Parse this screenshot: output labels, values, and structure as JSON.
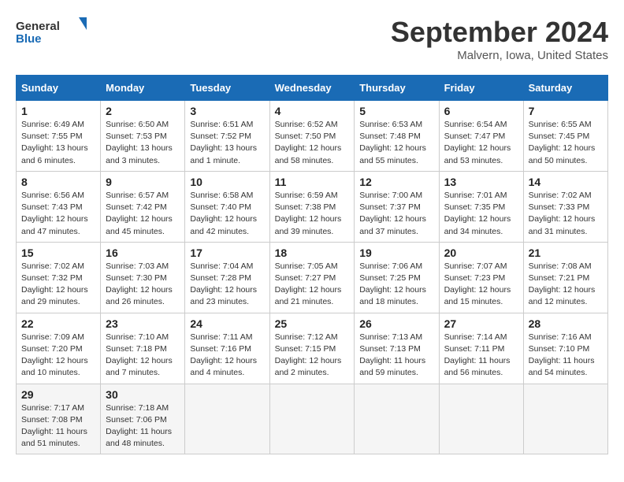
{
  "logo": {
    "line1": "General",
    "line2": "Blue"
  },
  "title": "September 2024",
  "location": "Malvern, Iowa, United States",
  "days_header": [
    "Sunday",
    "Monday",
    "Tuesday",
    "Wednesday",
    "Thursday",
    "Friday",
    "Saturday"
  ],
  "weeks": [
    [
      {
        "day": "1",
        "info": "Sunrise: 6:49 AM\nSunset: 7:55 PM\nDaylight: 13 hours\nand 6 minutes."
      },
      {
        "day": "2",
        "info": "Sunrise: 6:50 AM\nSunset: 7:53 PM\nDaylight: 13 hours\nand 3 minutes."
      },
      {
        "day": "3",
        "info": "Sunrise: 6:51 AM\nSunset: 7:52 PM\nDaylight: 13 hours\nand 1 minute."
      },
      {
        "day": "4",
        "info": "Sunrise: 6:52 AM\nSunset: 7:50 PM\nDaylight: 12 hours\nand 58 minutes."
      },
      {
        "day": "5",
        "info": "Sunrise: 6:53 AM\nSunset: 7:48 PM\nDaylight: 12 hours\nand 55 minutes."
      },
      {
        "day": "6",
        "info": "Sunrise: 6:54 AM\nSunset: 7:47 PM\nDaylight: 12 hours\nand 53 minutes."
      },
      {
        "day": "7",
        "info": "Sunrise: 6:55 AM\nSunset: 7:45 PM\nDaylight: 12 hours\nand 50 minutes."
      }
    ],
    [
      {
        "day": "8",
        "info": "Sunrise: 6:56 AM\nSunset: 7:43 PM\nDaylight: 12 hours\nand 47 minutes."
      },
      {
        "day": "9",
        "info": "Sunrise: 6:57 AM\nSunset: 7:42 PM\nDaylight: 12 hours\nand 45 minutes."
      },
      {
        "day": "10",
        "info": "Sunrise: 6:58 AM\nSunset: 7:40 PM\nDaylight: 12 hours\nand 42 minutes."
      },
      {
        "day": "11",
        "info": "Sunrise: 6:59 AM\nSunset: 7:38 PM\nDaylight: 12 hours\nand 39 minutes."
      },
      {
        "day": "12",
        "info": "Sunrise: 7:00 AM\nSunset: 7:37 PM\nDaylight: 12 hours\nand 37 minutes."
      },
      {
        "day": "13",
        "info": "Sunrise: 7:01 AM\nSunset: 7:35 PM\nDaylight: 12 hours\nand 34 minutes."
      },
      {
        "day": "14",
        "info": "Sunrise: 7:02 AM\nSunset: 7:33 PM\nDaylight: 12 hours\nand 31 minutes."
      }
    ],
    [
      {
        "day": "15",
        "info": "Sunrise: 7:02 AM\nSunset: 7:32 PM\nDaylight: 12 hours\nand 29 minutes."
      },
      {
        "day": "16",
        "info": "Sunrise: 7:03 AM\nSunset: 7:30 PM\nDaylight: 12 hours\nand 26 minutes."
      },
      {
        "day": "17",
        "info": "Sunrise: 7:04 AM\nSunset: 7:28 PM\nDaylight: 12 hours\nand 23 minutes."
      },
      {
        "day": "18",
        "info": "Sunrise: 7:05 AM\nSunset: 7:27 PM\nDaylight: 12 hours\nand 21 minutes."
      },
      {
        "day": "19",
        "info": "Sunrise: 7:06 AM\nSunset: 7:25 PM\nDaylight: 12 hours\nand 18 minutes."
      },
      {
        "day": "20",
        "info": "Sunrise: 7:07 AM\nSunset: 7:23 PM\nDaylight: 12 hours\nand 15 minutes."
      },
      {
        "day": "21",
        "info": "Sunrise: 7:08 AM\nSunset: 7:21 PM\nDaylight: 12 hours\nand 12 minutes."
      }
    ],
    [
      {
        "day": "22",
        "info": "Sunrise: 7:09 AM\nSunset: 7:20 PM\nDaylight: 12 hours\nand 10 minutes."
      },
      {
        "day": "23",
        "info": "Sunrise: 7:10 AM\nSunset: 7:18 PM\nDaylight: 12 hours\nand 7 minutes."
      },
      {
        "day": "24",
        "info": "Sunrise: 7:11 AM\nSunset: 7:16 PM\nDaylight: 12 hours\nand 4 minutes."
      },
      {
        "day": "25",
        "info": "Sunrise: 7:12 AM\nSunset: 7:15 PM\nDaylight: 12 hours\nand 2 minutes."
      },
      {
        "day": "26",
        "info": "Sunrise: 7:13 AM\nSunset: 7:13 PM\nDaylight: 11 hours\nand 59 minutes."
      },
      {
        "day": "27",
        "info": "Sunrise: 7:14 AM\nSunset: 7:11 PM\nDaylight: 11 hours\nand 56 minutes."
      },
      {
        "day": "28",
        "info": "Sunrise: 7:16 AM\nSunset: 7:10 PM\nDaylight: 11 hours\nand 54 minutes."
      }
    ],
    [
      {
        "day": "29",
        "info": "Sunrise: 7:17 AM\nSunset: 7:08 PM\nDaylight: 11 hours\nand 51 minutes."
      },
      {
        "day": "30",
        "info": "Sunrise: 7:18 AM\nSunset: 7:06 PM\nDaylight: 11 hours\nand 48 minutes."
      },
      null,
      null,
      null,
      null,
      null
    ]
  ]
}
